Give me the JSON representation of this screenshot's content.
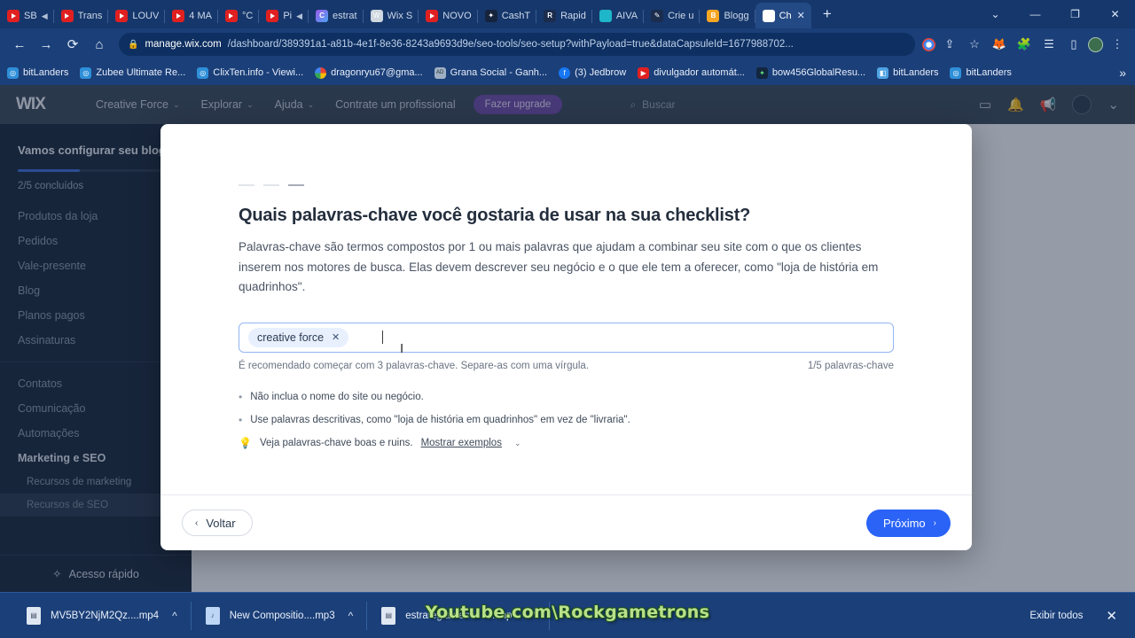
{
  "browser": {
    "tabs": [
      {
        "label": "SB",
        "icon": "youtube-icon",
        "muted": true
      },
      {
        "label": "Trans",
        "icon": "youtube-icon",
        "muted": false
      },
      {
        "label": "LOUV",
        "icon": "youtube-icon",
        "muted": false
      },
      {
        "label": "4 MA",
        "icon": "youtube-icon",
        "muted": false
      },
      {
        "label": "°C",
        "icon": "youtube-icon",
        "muted": false
      },
      {
        "label": "Pi",
        "icon": "youtube-icon",
        "muted": true
      },
      {
        "label": "estrat",
        "icon": "circle-gradient-icon",
        "muted": false
      },
      {
        "label": "Wix S",
        "icon": "wix-studio-icon",
        "muted": false
      },
      {
        "label": "NOVO",
        "icon": "youtube-icon",
        "muted": false
      },
      {
        "label": "CashT",
        "icon": "cashtree-icon",
        "muted": false
      },
      {
        "label": "Rapid",
        "icon": "rapid-icon",
        "muted": false
      },
      {
        "label": "AIVA",
        "icon": "aiva-icon",
        "muted": false
      },
      {
        "label": "Crie u",
        "icon": "crie-icon",
        "muted": false
      },
      {
        "label": "Blogg",
        "icon": "blogger-icon",
        "muted": false
      },
      {
        "label": "Ch",
        "icon": "wix-icon",
        "muted": false,
        "active": true
      }
    ],
    "new_tab_glyph": "+",
    "window_controls": {
      "chevron": "⌄",
      "minimize": "—",
      "maximize": "❐",
      "close": "✕"
    },
    "nav": {
      "back": "←",
      "forward": "→",
      "reload": "⟳",
      "home": "⌂"
    },
    "url": {
      "lock": "🔒",
      "host": "manage.wix.com",
      "path": "/dashboard/389391a1-a81b-4e1f-8e36-8243a9693d9e/seo-tools/seo-setup?withPayload=true&dataCapsuleId=1677988702..."
    },
    "omni_icons": [
      "google-icon",
      "share-icon",
      "bookmark-star-icon",
      "extension-orange-icon",
      "extension-puzzle-icon",
      "playlist-icon",
      "sidepanel-icon",
      "profile-avatar-icon",
      "kebab-menu-icon"
    ],
    "bookmarks": [
      {
        "label": "bitLanders",
        "icon": "blue-globe-icon"
      },
      {
        "label": "Zubee Ultimate Re...",
        "icon": "blue-globe-icon"
      },
      {
        "label": "ClixTen.info - Viewi...",
        "icon": "blue-globe-icon"
      },
      {
        "label": "dragonryu67@gma...",
        "icon": "google-icon"
      },
      {
        "label": "Grana Social - Ganh...",
        "icon": "gray-icon"
      },
      {
        "label": "(3) Jedbrow",
        "icon": "facebook-icon"
      },
      {
        "label": "divulgador automát...",
        "icon": "youtube-icon"
      },
      {
        "label": "bow456GlobalResu...",
        "icon": "green-icon"
      },
      {
        "label": "bitLanders",
        "icon": "lightblue-icon"
      },
      {
        "label": "bitLanders",
        "icon": "blue-globe-icon"
      }
    ],
    "bookmarks_overflow": "»"
  },
  "wix_header": {
    "logo": "WIX",
    "site_name": "Creative Force",
    "menu": [
      "Explorar",
      "Ajuda",
      "Contrate um profissional"
    ],
    "upgrade_label": "Fazer upgrade",
    "search_placeholder": "Buscar",
    "icons": [
      "chat-icon",
      "bell-icon",
      "megaphone-icon",
      "avatar-icon",
      "chevron-down-icon"
    ]
  },
  "sidebar": {
    "title": "Vamos configurar seu blog",
    "progress_label": "2/5 concluídos",
    "progress_percent": 40,
    "items": [
      {
        "label": "Produtos da loja",
        "style": "normal"
      },
      {
        "label": "Pedidos",
        "style": "normal"
      },
      {
        "label": "Vale-presente",
        "style": "normal"
      },
      {
        "label": "Blog",
        "style": "normal"
      },
      {
        "label": "Planos pagos",
        "style": "normal"
      },
      {
        "label": "Assinaturas",
        "style": "normal"
      },
      {
        "label": "Contatos",
        "style": "normal"
      },
      {
        "label": "Comunicação",
        "style": "normal"
      },
      {
        "label": "Automações",
        "style": "normal"
      },
      {
        "label": "Marketing e SEO",
        "style": "bold"
      },
      {
        "label": "Recursos de marketing",
        "style": "sub"
      },
      {
        "label": "Recursos de SEO",
        "style": "sub-selected"
      }
    ],
    "quick_access": {
      "label": "Acesso rápido",
      "icon": "sparkle-icon"
    }
  },
  "modal": {
    "steps": [
      {
        "active": false
      },
      {
        "active": false
      },
      {
        "active": true
      }
    ],
    "title": "Quais palavras-chave você gostaria de usar na sua checklist?",
    "description": "Palavras-chave são termos compostos por 1 ou mais palavras que ajudam a combinar seu site com o que os clientes inserem nos motores de busca. Elas devem descrever seu negócio e o que ele tem a oferecer, como \"loja de história em quadrinhos\".",
    "keyword_chips": [
      {
        "label": "creative force",
        "remove_glyph": "✕"
      }
    ],
    "input_placeholder": "",
    "helper_text": "É recomendado começar com 3 palavras-chave. Separe-as com uma vírgula.",
    "counter": "1/5 palavras-chave",
    "hints": [
      {
        "bullet": "•",
        "text": "Não inclua o nome do site ou negócio."
      },
      {
        "bullet": "•",
        "text": "Use palavras descritivas, como \"loja de história em quadrinhos\" em vez de \"livraria\"."
      }
    ],
    "hint_link": {
      "icon": "lightbulb-icon",
      "text": "Veja palavras-chave boas e ruins.",
      "link_label": "Mostrar exemplos",
      "chevron": "⌄"
    },
    "back_label": "Voltar",
    "back_arrow": "‹",
    "next_label": "Próximo",
    "next_arrow": "›",
    "accent_color": "#2a63f6"
  },
  "downloads": {
    "items": [
      {
        "label": "MV5BY2NjM2Qz....mp4",
        "icon": "file-mp4-icon",
        "caret": "^"
      },
      {
        "label": "New Compositio....mp3",
        "icon": "file-mp3-icon",
        "caret": "^"
      },
      {
        "label": "estrategia desenn....mp4",
        "icon": "file-mp4-icon",
        "caret": "^"
      }
    ],
    "show_all_label": "Exibir todos",
    "close_glyph": "✕"
  },
  "watermark": "Youtube.com\\Rockgametrons"
}
